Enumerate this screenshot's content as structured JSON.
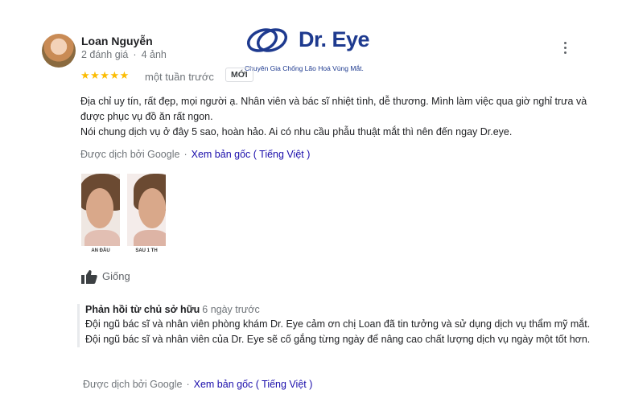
{
  "reviewer": {
    "name": "Loan Nguyễn",
    "review_count": "2 đánh giá",
    "photo_count": "4 ảnh"
  },
  "logo": {
    "text": "Dr. Eye",
    "tagline": "Chuyên Gia Chống Lão Hoá Vùng Mắt.",
    "color": "#1e3a8f"
  },
  "review": {
    "stars": "★★★★★",
    "rating": 5,
    "time": "một tuần trước",
    "badge": "MỚI",
    "line1": "Địa chỉ uy tín, rất đẹp, mọi người ạ. Nhân viên và bác sĩ nhiệt tình, dễ thương. Mình làm việc qua giờ nghỉ trưa và được phục vụ đồ ăn rất ngon.",
    "line2": "Nói chung dịch vụ ở đây 5 sao, hoàn hảo. Ai có nhu cầu phẫu thuật mắt thì nên đến ngay Dr.eye.",
    "translated_by": "Được dịch bởi Google",
    "see_original": "Xem bản gốc ( Tiếng Việt )"
  },
  "photos": [
    {
      "caption": "AN ĐẦU"
    },
    {
      "caption": "SAU 1 TH"
    }
  ],
  "like": {
    "label": "Giống"
  },
  "owner_reply": {
    "title": "Phản hồi từ chủ sở hữu",
    "time": "6 ngày trước",
    "body": "Đội ngũ bác sĩ và nhân viên phòng khám Dr. Eye cảm ơn chị Loan đã tin tưởng và sử dụng dịch vụ thẩm mỹ mắt. Đội ngũ bác sĩ và nhân viên của Dr. Eye sẽ cố gắng từng ngày để nâng cao chất lượng dịch vụ ngày một tốt hơn.",
    "translated_by": "Được dịch bởi Google",
    "see_original": "Xem bản gốc ( Tiếng Việt )"
  },
  "icons": [
    "more-vert-icon",
    "thumbs-up-icon",
    "dr-eye-logo-icon"
  ]
}
